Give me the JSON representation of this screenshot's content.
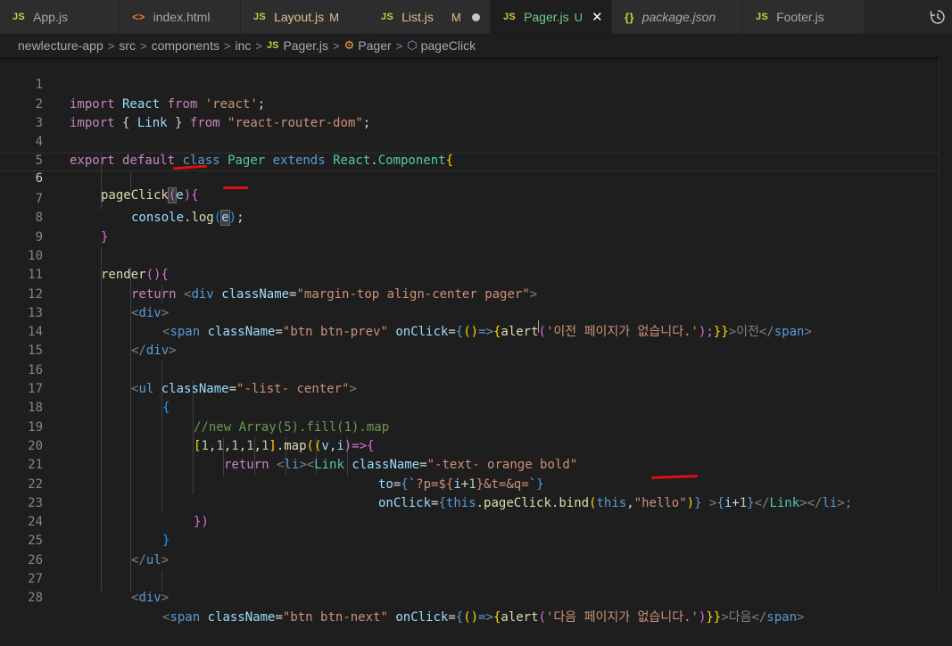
{
  "tabs": [
    {
      "icon": "JS",
      "label": "App.js",
      "status": "",
      "style": "normal"
    },
    {
      "icon": "<>",
      "label": "index.html",
      "status": "",
      "style": "normal"
    },
    {
      "icon": "JS",
      "label": "Layout.js",
      "status": "M",
      "style": "mod"
    },
    {
      "icon": "JS",
      "label": "List.js",
      "status": "M",
      "style": "mod"
    },
    {
      "icon": "JS",
      "label": "Pager.js",
      "status": "U",
      "style": "untracked"
    },
    {
      "icon": "{}",
      "label": "package.json",
      "status": "",
      "style": "italic"
    },
    {
      "icon": "JS",
      "label": "Footer.js",
      "status": "",
      "style": "normal"
    }
  ],
  "breadcrumb": {
    "p1": "newlecture-app",
    "p2": "src",
    "p3": "components",
    "p4": "inc",
    "file_icon": "JS",
    "file": "Pager.js",
    "cls": "Pager",
    "method": "pageClick",
    "sep": ">"
  },
  "line_numbers": [
    "1",
    "2",
    "3",
    "4",
    "5",
    "6",
    "7",
    "8",
    "9",
    "10",
    "11",
    "12",
    "13",
    "14",
    "15",
    "16",
    "17",
    "18",
    "19",
    "20",
    "21",
    "22",
    "23",
    "24",
    "25",
    "26",
    "27",
    "28"
  ],
  "code": {
    "l1": {
      "a": "import",
      "b": " React ",
      "c": "from",
      "d": " ",
      "e": "'react'",
      "f": ";"
    },
    "l2": {
      "a": "import",
      "b": " { ",
      "c": "Link",
      "d": " } ",
      "e": "from",
      "f": " ",
      "g": "\"react-router-dom\"",
      "h": ";"
    },
    "l4": {
      "a": "export",
      "b": " ",
      "c": "default",
      "d": " ",
      "e": "class",
      "f": " ",
      "g": "Pager",
      "h": " ",
      "i": "extends",
      "j": " ",
      "k": "React",
      "l": ".",
      "m": "Component",
      "n": "{"
    },
    "l6": {
      "a": "pageClick",
      "b": "(",
      "c": "e",
      "d": ")",
      "e": "{"
    },
    "l7": {
      "a": "console",
      "b": ".",
      "c": "log",
      "d": "(",
      "e": "e",
      "f": ")",
      "g": ";"
    },
    "l8": {
      "a": "}"
    },
    "l10": {
      "a": "render",
      "b": "()",
      "c": "{"
    },
    "l11": {
      "a": "return",
      "b": " ",
      "c": "<",
      "d": "div",
      "e": " ",
      "f": "className",
      "g": "=",
      "h": "\"margin-top align-center pager\"",
      "i": ">"
    },
    "l12": {
      "a": "<",
      "b": "div",
      "c": ">"
    },
    "l13": {
      "a": "<",
      "b": "span",
      "c": " ",
      "d": "className",
      "e": "=",
      "f": "\"btn btn-prev\"",
      "g": " ",
      "h": "onClick",
      "i": "=",
      "j": "{",
      "k": "()",
      "l": "=>",
      "m": "{",
      "n": "alert",
      "o": "(",
      "p": "'이전 페이지가 없습니다.'",
      "q": ");",
      "r": "}}",
      "s": ">이전",
      "t": "</",
      "u": "span",
      "w": ">"
    },
    "l14": {
      "a": "</",
      "b": "div",
      "c": ">"
    },
    "l16": {
      "a": "<",
      "b": "ul",
      "c": " ",
      "d": "className",
      "e": "=",
      "f": "\"-list- center\"",
      "g": ">"
    },
    "l17": {
      "a": "{"
    },
    "l18": {
      "a": "//new Array(5).fill(1).map"
    },
    "l19": {
      "a": "[",
      "b": "1",
      "c": ",",
      "d": "1",
      "e": ",",
      "f": "1",
      "g": ",",
      "h": "1",
      "i": ",",
      "j": "1",
      "k": "]",
      "l": ".",
      "m": "map",
      "n": "((",
      "o": "v",
      "p": ",",
      "q": "i",
      "r": ")=>",
      "s": "{"
    },
    "l20": {
      "a": "return",
      "b": " ",
      "c": "<",
      "d": "li",
      "e": "><",
      "f": "Link",
      "g": " ",
      "h": "className",
      "i": "=",
      "j": "\"-text- orange bold\""
    },
    "l21": {
      "a": "to",
      "b": "=",
      "c": "{",
      "d": "`?p=${",
      "e": "i",
      "f": "+",
      "g": "1",
      "h": "}&t=&q=`",
      "i": "}"
    },
    "l22": {
      "a": "onClick",
      "b": "=",
      "c": "{",
      "d": "this",
      "e": ".",
      "f": "pageClick",
      "g": ".",
      "h": "bind",
      "i": "(",
      "j": "this",
      "k": ",",
      "l": "\"hello\"",
      "m": ")",
      "n": "}",
      "o": " >",
      "p": "{",
      "q": "i",
      "r": "+",
      "s": "1",
      "t": "}",
      "u": "</",
      "w": "Link",
      "x": "></",
      "y": "li",
      "z": ">;"
    },
    "l23": {
      "a": "})"
    },
    "l24": {
      "a": "}"
    },
    "l25": {
      "a": "</",
      "b": "ul",
      "c": ">"
    },
    "l27": {
      "a": "<",
      "b": "div",
      "c": ">"
    },
    "l28": {
      "a": "<",
      "b": "span",
      "c": " ",
      "d": "className",
      "e": "=",
      "f": "\"btn btn-next\"",
      "g": " ",
      "h": "onClick",
      "i": "=",
      "j": "{",
      "k": "()",
      "l": "=>",
      "m": "{",
      "n": "alert",
      "o": "(",
      "p": "'다음 페이지가 없습니다.'",
      "q": ")",
      "r": "}}",
      "s": ">다음",
      "t": "</",
      "u": "span",
      "w": ">"
    }
  },
  "colors": {
    "background": "#1e1e1e",
    "tab_active": "#1e1e1e",
    "tab_inactive": "#2d2d2d",
    "keyword": "#c586c0",
    "storage": "#569cd6",
    "string": "#ce9178",
    "comment": "#6a9955",
    "function": "#dcdcaa",
    "variable": "#9cdcfe",
    "type": "#4ec9b0",
    "annotation_red": "#e01010"
  },
  "icons": {
    "history": "history-icon",
    "close": "close-icon"
  }
}
